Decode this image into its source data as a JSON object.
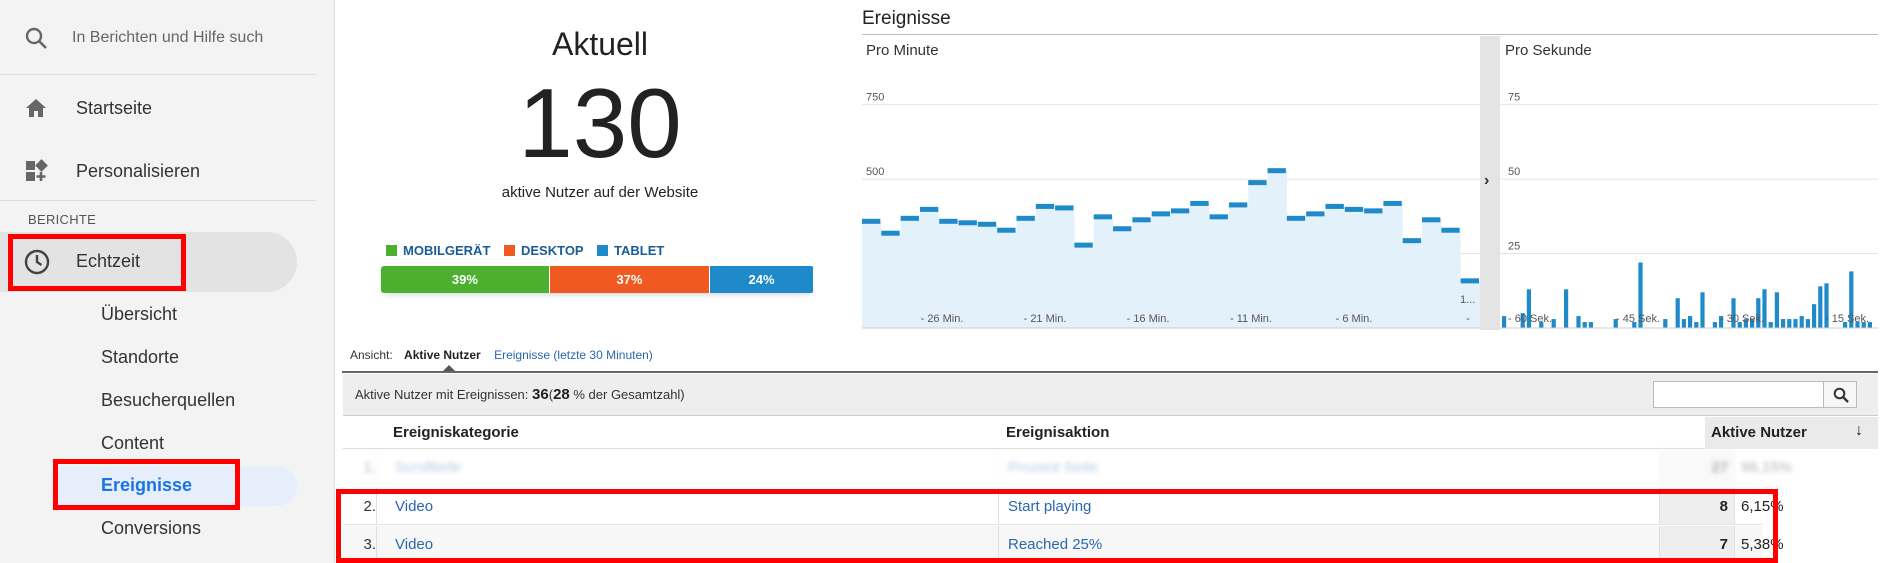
{
  "sidebar": {
    "search_placeholder": "In Berichten und Hilfe such",
    "home_label": "Startseite",
    "personalize_label": "Personalisieren",
    "section_label": "BERICHTE",
    "realtime_label": "Echtzeit",
    "sub_items": [
      "Übersicht",
      "Standorte",
      "Besucherquellen",
      "Content",
      "Ereignisse",
      "Conversions"
    ],
    "active_sub": "Ereignisse"
  },
  "overview": {
    "heading": "Aktuell",
    "active_users": "130",
    "subtitle": "aktive Nutzer auf der Website",
    "devices": [
      {
        "label": "MOBILGERÄT",
        "percent": 39,
        "percent_label": "39%",
        "color": "#4caf2e"
      },
      {
        "label": "DESKTOP",
        "percent": 37,
        "percent_label": "37%",
        "color": "#f05a20"
      },
      {
        "label": "TABLET",
        "percent": 24,
        "percent_label": "24%",
        "color": "#1f8ac9"
      }
    ]
  },
  "events_chart": {
    "title": "Ereignisse",
    "per_minute_label": "Pro Minute",
    "per_second_label": "Pro Sekunde",
    "expand_glyph": "›"
  },
  "chart_data": [
    {
      "type": "bar",
      "title": "Pro Minute",
      "ylim": [
        0,
        900
      ],
      "y_ticks": [
        "750",
        "500",
        "250"
      ],
      "x_ticks": [
        "- 26 Min.",
        "- 21 Min.",
        "- 16 Min.",
        "- 11 Min.",
        "- 6 Min.",
        "-"
      ],
      "cut_label": "1...",
      "values": [
        360,
        320,
        370,
        400,
        360,
        355,
        350,
        330,
        370,
        410,
        405,
        280,
        375,
        335,
        365,
        385,
        395,
        420,
        375,
        415,
        490,
        530,
        370,
        385,
        410,
        400,
        395,
        420,
        295,
        365,
        330,
        160
      ],
      "color": "#1f8ac9",
      "area_color": "#e3f1fa"
    },
    {
      "type": "bar",
      "title": "Pro Sekunde",
      "ylim": [
        0,
        90
      ],
      "y_ticks": [
        "75",
        "50",
        "25"
      ],
      "x_ticks": [
        "- 60 Sek.",
        "- 45 Sek.",
        "- 30 Sek.",
        "- 15 Sek."
      ],
      "values": [
        4,
        0,
        0,
        5,
        13,
        0,
        2,
        0,
        3,
        0,
        13,
        0,
        4,
        2,
        2,
        0,
        0,
        0,
        3,
        0,
        0,
        2,
        22,
        0,
        0,
        0,
        3,
        0,
        10,
        3,
        4,
        2,
        12,
        0,
        2,
        4,
        0,
        10,
        2,
        3,
        3,
        10,
        13,
        2,
        12,
        3,
        3,
        3,
        4,
        3,
        8,
        14,
        15,
        0,
        0,
        2,
        19,
        2,
        2,
        2
      ],
      "color": "#1f8ac9"
    }
  ],
  "view": {
    "label": "Ansicht:",
    "active_tab": "Aktive Nutzer",
    "other_tab": "Ereignisse (letzte 30 Minuten)"
  },
  "summary": {
    "prefix": "Aktive Nutzer mit Ereignissen:",
    "count": "36",
    "open_paren": "(",
    "percent": "28",
    "suffix": "% der Gesamtzahl)"
  },
  "table": {
    "headers": {
      "category": "Ereigniskategorie",
      "action": "Ereignisaktion",
      "users": "Aktive Nutzer"
    },
    "rows": [
      {
        "index": "1.",
        "category": "Scrolltiefe",
        "action": "Prozent Seite",
        "users": "27",
        "percent": "96,15%"
      },
      {
        "index": "2.",
        "category": "Video",
        "action": "Start playing",
        "users": "8",
        "percent": "6,15%"
      },
      {
        "index": "3.",
        "category": "Video",
        "action": "Reached 25%",
        "users": "7",
        "percent": "5,38%"
      }
    ]
  }
}
